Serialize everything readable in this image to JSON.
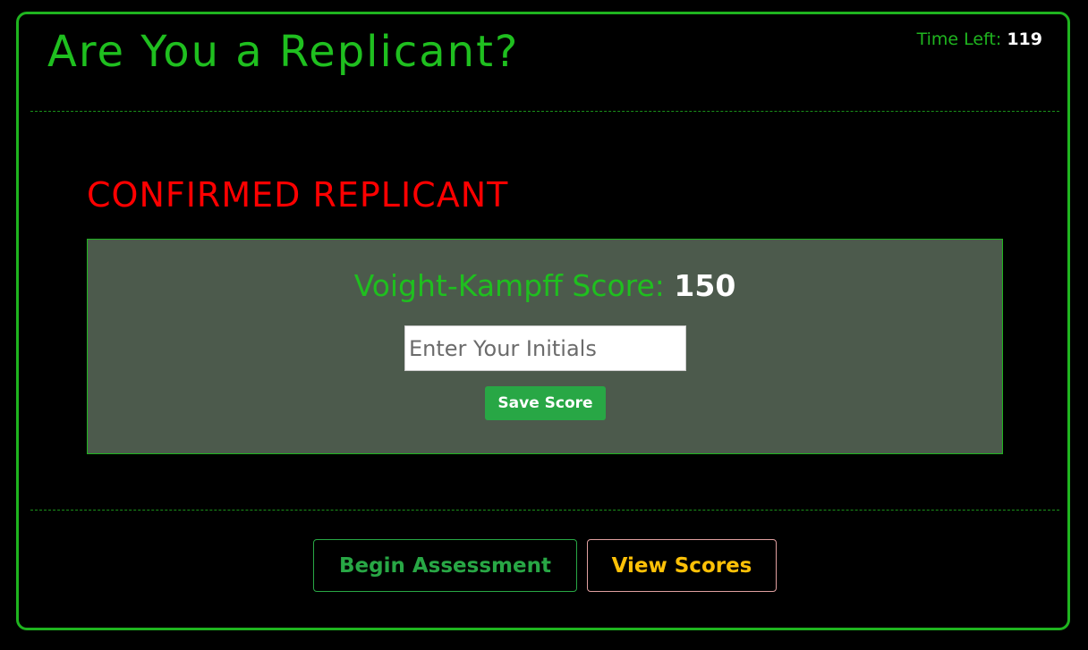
{
  "header": {
    "title": "Are You a Replicant?",
    "timer_label": "Time Left:",
    "timer_value": "119"
  },
  "result": {
    "heading": "CONFIRMED REPLICANT",
    "score_label": "Voight-Kampff Score:",
    "score_value": "150",
    "initials_placeholder": "Enter Your Initials",
    "initials_value": "",
    "save_label": "Save Score"
  },
  "footer": {
    "begin_label": "Begin Assessment",
    "view_scores_label": "View Scores"
  },
  "colors": {
    "accent_green": "#1fb41f",
    "alert_red": "#ff0000",
    "panel_bg": "#4c5a4c",
    "button_green": "#28a745",
    "button_yellow": "#ffc107"
  }
}
